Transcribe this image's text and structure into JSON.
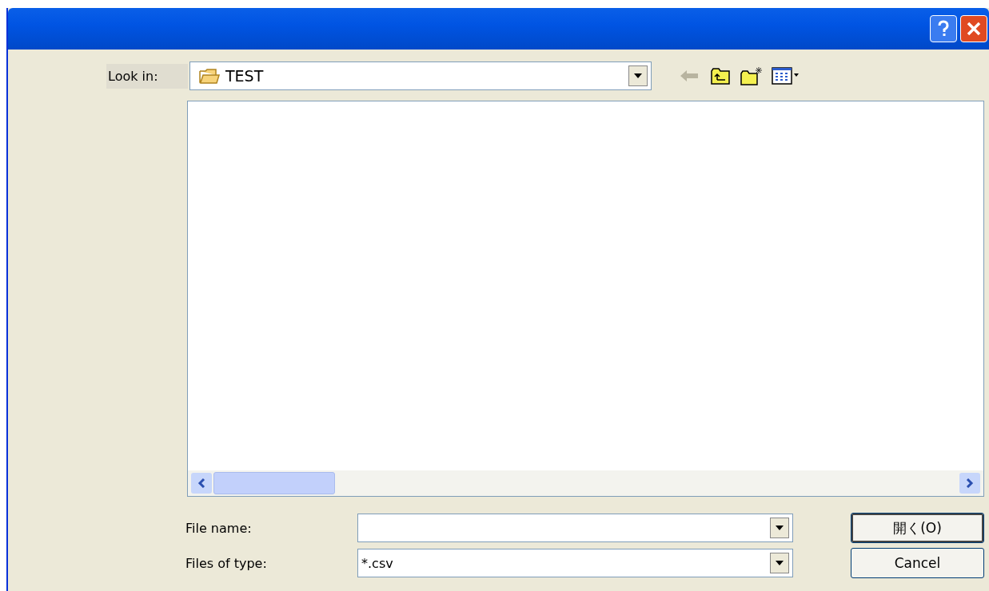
{
  "look_in": {
    "label": "Look in:",
    "value": "TEST"
  },
  "file_name": {
    "label": "File name:"
  },
  "file_type": {
    "label": "Files of type:",
    "value": "*.csv"
  },
  "buttons": [
    {
      "label": "開く(O)",
      "kind": "default"
    },
    {
      "label": "Cancel",
      "kind": "normal"
    }
  ]
}
